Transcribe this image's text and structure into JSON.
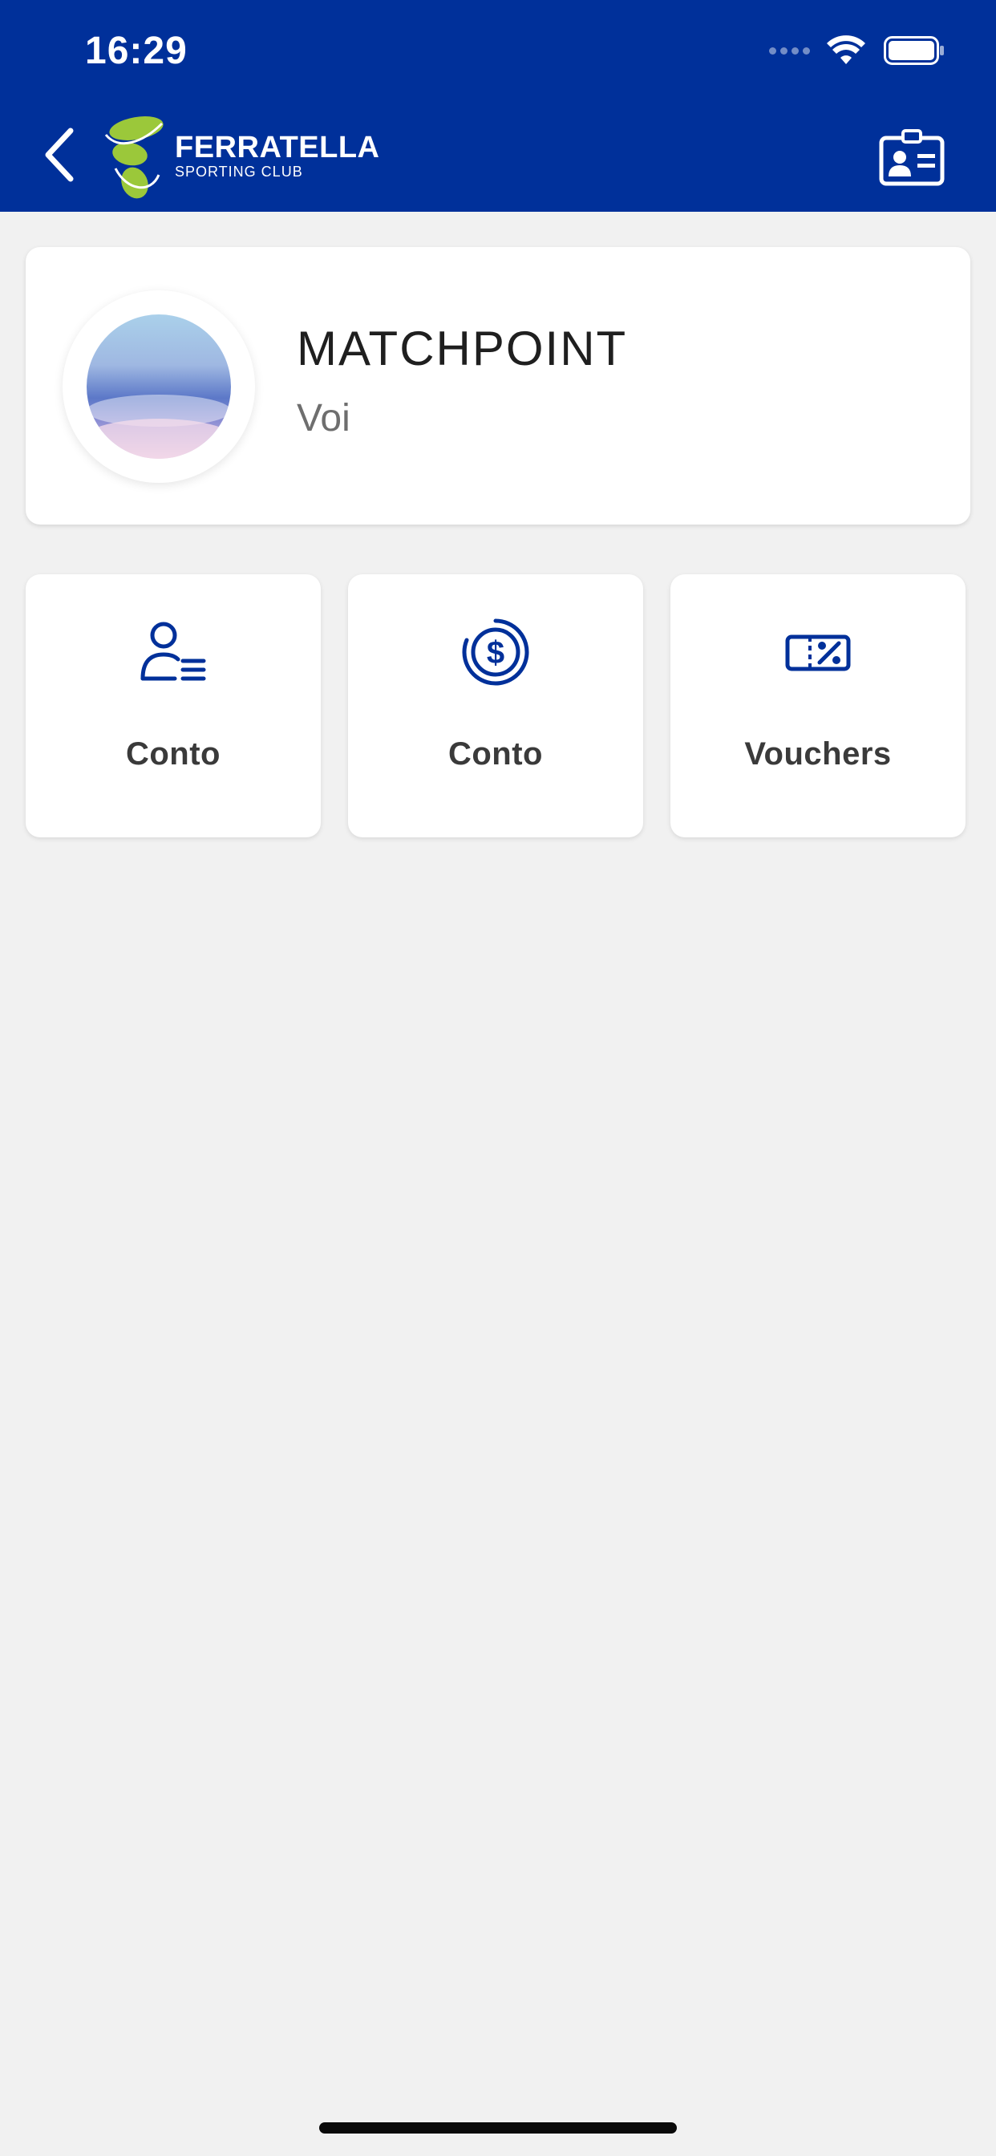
{
  "status_bar": {
    "time": "16:29"
  },
  "header": {
    "logo": {
      "title": "FERRATELLA",
      "subtitle": "SPORTING CLUB"
    },
    "back_icon": "chevron-left-icon",
    "right_icon": "id-card-icon"
  },
  "profile": {
    "name": "MATCHPOINT",
    "subtitle": "Voi"
  },
  "tiles": [
    {
      "label": "Conto",
      "icon": "user-list-icon"
    },
    {
      "label": "Conto",
      "icon": "dollar-coin-icon"
    },
    {
      "label": "Vouchers",
      "icon": "voucher-percent-icon"
    }
  ],
  "colors": {
    "header_bg": "#00309a",
    "accent": "#00309a",
    "background": "#f1f1f1",
    "logo_green": "#9bc83a"
  }
}
